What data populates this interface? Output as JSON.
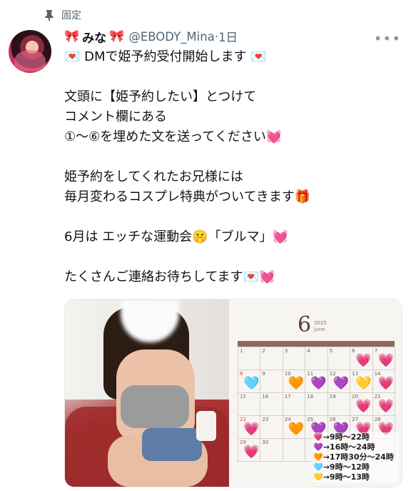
{
  "pinned_label": "固定",
  "author": {
    "name_prefix": "🎀",
    "name": "みな",
    "name_suffix": "🎀",
    "handle": "@EBODY_Mina",
    "separator": "·",
    "time": "1日"
  },
  "more_icon": "more-dots-icon",
  "tweet_text": "💌 DMで姫予約受付開始します 💌\n\n文頭に【姫予約したい】とつけて\nコメント欄にある\n①〜⑥を埋めた文を送ってください💓\n\n姫予約をしてくれたお兄様には\n毎月変わるコスプレ特典がついてきます🎁\n\n6月は エッチな運動会🤫「ブルマ」💓\n\nたくさんご連絡お待ちしてます💌💓",
  "calendar": {
    "month": "6",
    "year": "2025",
    "month_name": "June",
    "cells": [
      {
        "d": "1",
        "red": true,
        "h": ""
      },
      {
        "d": "2",
        "h": ""
      },
      {
        "d": "3",
        "h": ""
      },
      {
        "d": "4",
        "h": ""
      },
      {
        "d": "5",
        "h": ""
      },
      {
        "d": "6",
        "h": "💗"
      },
      {
        "d": "7",
        "h": "💗"
      },
      {
        "d": "8",
        "red": true,
        "h": "🩵"
      },
      {
        "d": "9",
        "h": ""
      },
      {
        "d": "10",
        "h": "🧡"
      },
      {
        "d": "11",
        "h": "💜"
      },
      {
        "d": "12",
        "h": "💜"
      },
      {
        "d": "13",
        "h": "💛"
      },
      {
        "d": "14",
        "h": "💗"
      },
      {
        "d": "15",
        "red": true,
        "h": ""
      },
      {
        "d": "16",
        "h": ""
      },
      {
        "d": "17",
        "h": ""
      },
      {
        "d": "18",
        "h": ""
      },
      {
        "d": "19",
        "h": ""
      },
      {
        "d": "20",
        "h": "💗"
      },
      {
        "d": "21",
        "h": "💗"
      },
      {
        "d": "22",
        "red": true,
        "h": "💗"
      },
      {
        "d": "23",
        "h": ""
      },
      {
        "d": "24",
        "h": "🧡"
      },
      {
        "d": "25",
        "h": "💜"
      },
      {
        "d": "26",
        "h": "💜"
      },
      {
        "d": "27",
        "h": "💗"
      },
      {
        "d": "28",
        "h": "💗"
      },
      {
        "d": "29",
        "red": true,
        "h": "💗"
      },
      {
        "d": "30",
        "h": ""
      },
      {
        "d": "",
        "h": ""
      },
      {
        "d": "",
        "h": ""
      },
      {
        "d": "",
        "h": ""
      },
      {
        "d": "",
        "h": ""
      },
      {
        "d": "",
        "h": ""
      }
    ],
    "legend": [
      "💗→9時〜22時",
      "💜→16時〜24時",
      "🧡→17時30分〜24時",
      "🩵→9時〜12時",
      "💛→9時〜13時"
    ]
  }
}
